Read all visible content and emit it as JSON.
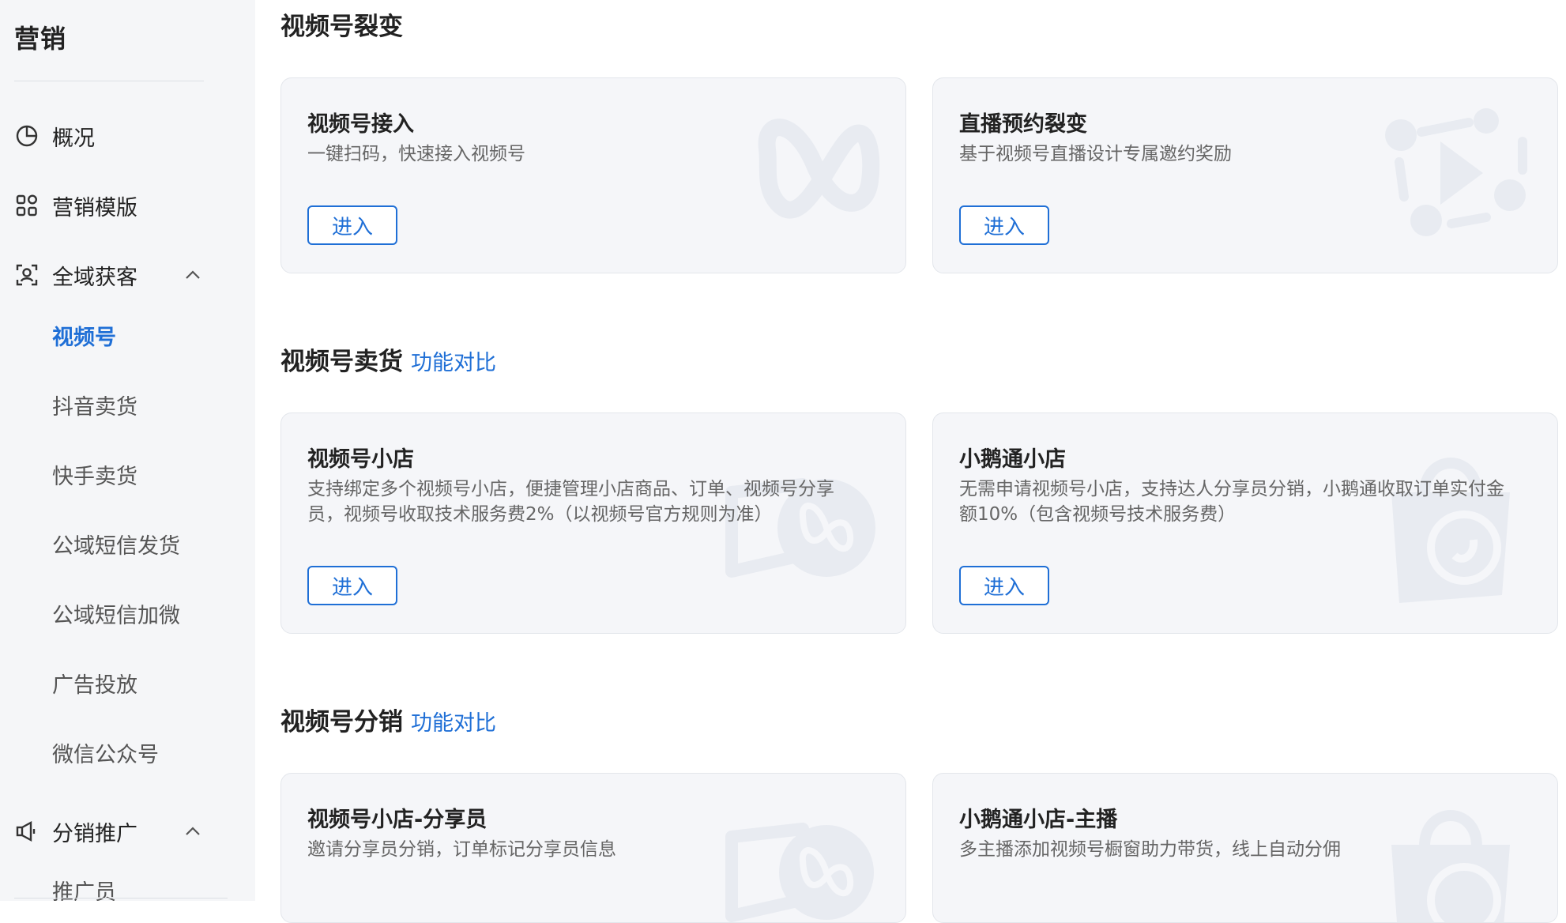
{
  "sidebar": {
    "title": "营销",
    "items": [
      {
        "label": "概况",
        "icon": "pie-chart-icon"
      },
      {
        "label": "营销模版",
        "icon": "grid-icon"
      },
      {
        "label": "全域获客",
        "icon": "user-scan-icon"
      }
    ],
    "sub_items": [
      "视频号",
      "抖音卖货",
      "快手卖货",
      "公域短信发货",
      "公域短信加微",
      "广告投放",
      "微信公众号"
    ],
    "group2": {
      "label": "分销推广",
      "icon": "megaphone-icon"
    },
    "group2_sub": [
      "推广员"
    ]
  },
  "sections": [
    {
      "title": "视频号裂变",
      "link": ""
    },
    {
      "title": "视频号卖货",
      "link": "功能对比"
    },
    {
      "title": "视频号分销",
      "link": "功能对比"
    }
  ],
  "cards": [
    {
      "title": "视频号接入",
      "desc": "一键扫码，快速接入视频号",
      "button": "进入",
      "icon": "channels-logo-icon"
    },
    {
      "title": "直播预约裂变",
      "desc": "基于视频号直播设计专属邀约奖励",
      "button": "进入",
      "icon": "live-share-icon"
    },
    {
      "title": "视频号小店",
      "desc": "支持绑定多个视频号小店，便捷管理小店商品、订单、视频号分享员，视频号收取技术服务费2%（以视频号官方规则为准）",
      "button": "进入",
      "icon": "channels-shop-icon"
    },
    {
      "title": "小鹅通小店",
      "desc": "无需申请视频号小店，支持达人分享员分销，小鹅通收取订单实付金额10%（包含视频号技术服务费）",
      "button": "进入",
      "icon": "shopping-bag-icon"
    },
    {
      "title": "视频号小店-分享员",
      "desc": "邀请分享员分销，订单标记分享员信息",
      "icon": "channels-shop-icon"
    },
    {
      "title": "小鹅通小店-主播",
      "desc": "多主播添加视频号橱窗助力带货，线上自动分佣",
      "icon": "shopping-bag-icon"
    }
  ],
  "colors": {
    "accent": "#1f6fd6",
    "sidebar_bg": "#f5f6f8",
    "card_bg": "#f5f6f9"
  }
}
